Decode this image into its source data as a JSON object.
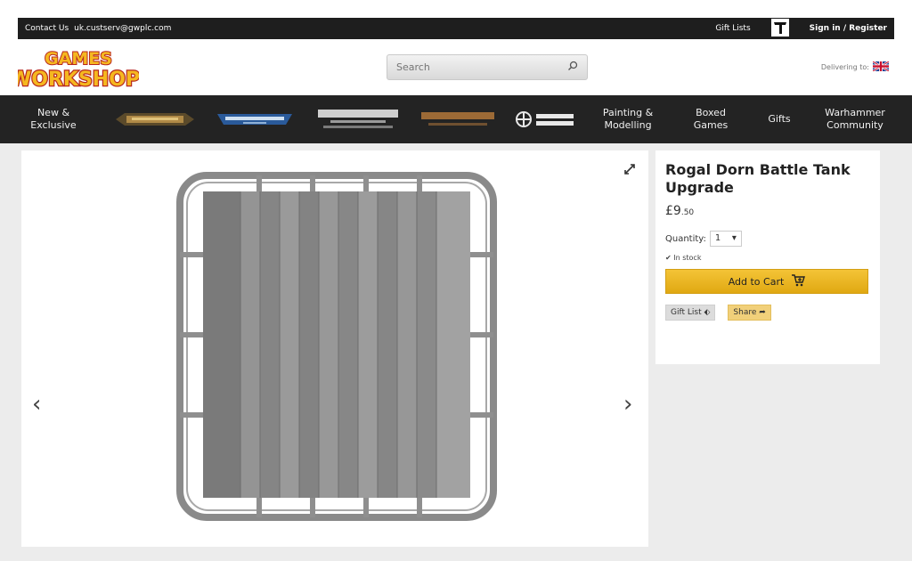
{
  "topbar": {
    "contact_label": "Contact Us",
    "contact_email": "uk.custserv@gwplc.com",
    "gift_lists": "Gift Lists",
    "sign_in": "Sign in / Register"
  },
  "header": {
    "logo_line1": "GAMES",
    "logo_line2": "WORKSHOP",
    "search_placeholder": "Search",
    "delivering_to": "Delivering to:"
  },
  "nav": {
    "items": [
      {
        "label_line1": "New &",
        "label_line2": "Exclusive"
      },
      {
        "brand": "WARHAMMER AGE OF SIGMAR"
      },
      {
        "brand": "WARHAMMER 40,000"
      },
      {
        "brand": "WARHAMMER THE HORUS HERESY"
      },
      {
        "brand": "MIDDLE-EARTH STRATEGY BATTLE GAME"
      },
      {
        "brand": "BLACK LIBRARY"
      },
      {
        "label_line1": "Painting &",
        "label_line2": "Modelling"
      },
      {
        "label_line1": "Boxed",
        "label_line2": "Games"
      },
      {
        "label_line1": "Gifts",
        "label_line2": ""
      },
      {
        "label_line1": "Warhammer",
        "label_line2": "Community"
      }
    ]
  },
  "product": {
    "title": "Rogal Dorn Battle Tank Upgrade",
    "price_main": "£9",
    "price_pence": ".50",
    "quantity_label": "Quantity:",
    "quantity_value": "1",
    "stock": "In stock",
    "add_to_cart": "Add to Cart",
    "gift_list": "Gift List",
    "share": "Share"
  },
  "colors": {
    "nav_bg": "#232323",
    "cart_yellow": "#f0bc2e",
    "brand_red": "#c8102e"
  }
}
